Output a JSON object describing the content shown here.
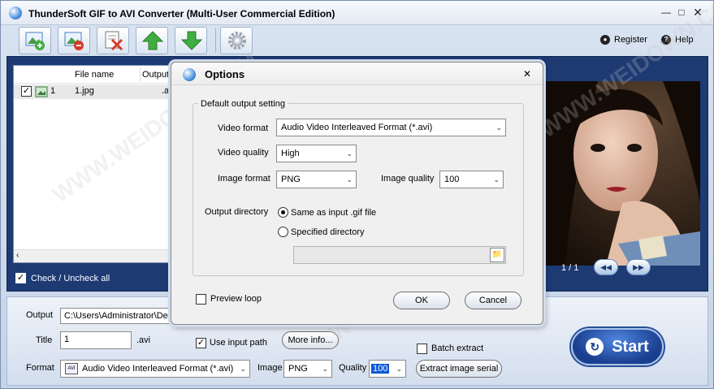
{
  "window": {
    "title": "ThunderSoft GIF to AVI Converter (Multi-User Commercial Edition)",
    "register_label": "Register",
    "help_label": "Help"
  },
  "file_list": {
    "columns": [
      "File name",
      "Output fo"
    ],
    "rows": [
      {
        "index": "1",
        "name": "1.jpg",
        "output": ".avi"
      }
    ],
    "check_all_label": "Check / Uncheck all"
  },
  "preview": {
    "page_counter": "1 / 1"
  },
  "bottom": {
    "output_label": "Output",
    "output_value": "C:\\Users\\Administrator\\Desk",
    "title_label": "Title",
    "title_value": "1",
    "title_ext": ".avi",
    "use_input_path_label": "Use input path",
    "more_info_label": "More info...",
    "batch_extract_label": "Batch extract",
    "format_label": "Format",
    "format_value": "Audio Video Interleaved Format (*.avi)",
    "format_icon_text": "AVI",
    "image_label": "Image",
    "image_value": "PNG",
    "quality_label": "Quality",
    "quality_value": "100",
    "extract_serial_label": "Extract image serial",
    "start_label": "Start"
  },
  "dialog": {
    "title": "Options",
    "group_label": "Default output setting",
    "video_format_label": "Video format",
    "video_format_value": "Audio Video Interleaved Format (*.avi)",
    "video_quality_label": "Video quality",
    "video_quality_value": "High",
    "image_format_label": "Image format",
    "image_format_value": "PNG",
    "image_quality_label": "Image quality",
    "image_quality_value": "100",
    "output_directory_label": "Output directory",
    "same_as_input_label": "Same as input .gif file",
    "specified_directory_label": "Specified directory",
    "preview_loop_label": "Preview loop",
    "ok_label": "OK",
    "cancel_label": "Cancel"
  },
  "watermark": "WWW.WEIDOWN.COM",
  "colors": {
    "accent": "#1d3a73",
    "start_button": "#1a3f8f",
    "toolbar_green": "#3fae3f"
  }
}
